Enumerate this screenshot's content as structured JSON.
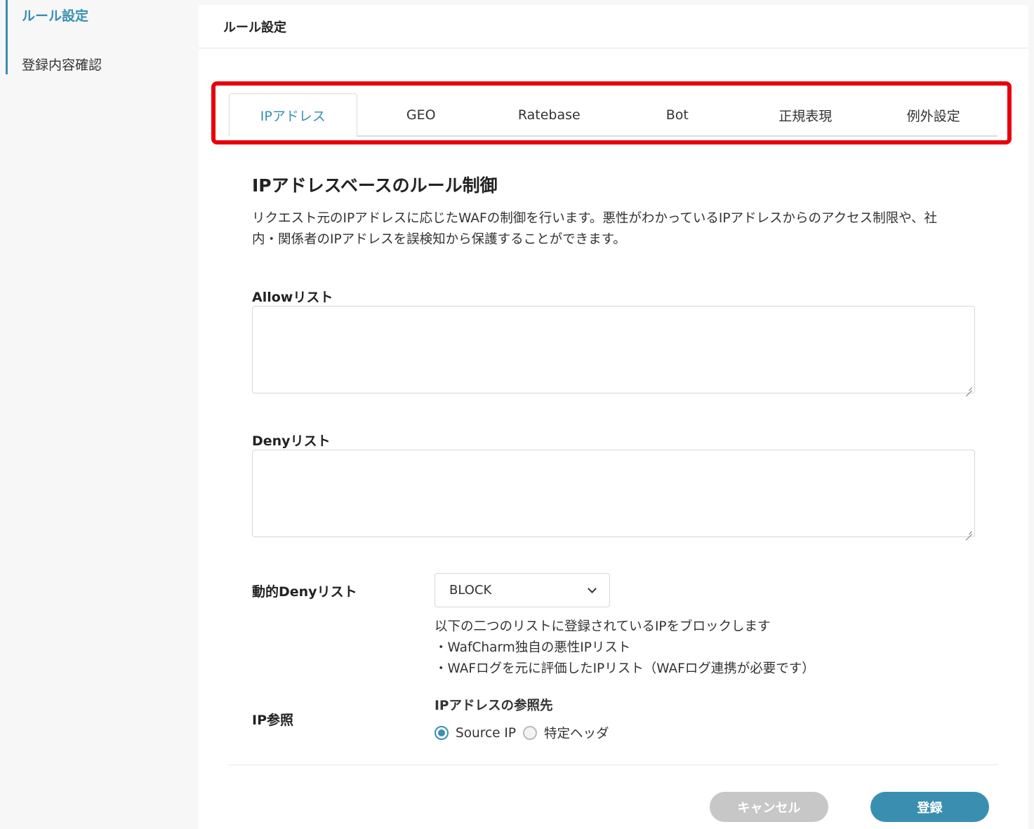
{
  "sidebar": {
    "items": [
      {
        "label": "ルール設定"
      },
      {
        "label": "登録内容確認"
      }
    ]
  },
  "header": {
    "title": "ルール設定"
  },
  "tabs": [
    {
      "label": "IPアドレス"
    },
    {
      "label": "GEO"
    },
    {
      "label": "Ratebase"
    },
    {
      "label": "Bot"
    },
    {
      "label": "正規表現"
    },
    {
      "label": "例外設定"
    }
  ],
  "section": {
    "title": "IPアドレスベースのルール制御",
    "description": "リクエスト元のIPアドレスに応じたWAFの制御を行います。悪性がわかっているIPアドレスからのアクセス制限や、社内・関係者のIPアドレスを誤検知から保護することができます。"
  },
  "allow": {
    "label": "Allowリスト",
    "value": ""
  },
  "deny": {
    "label": "Denyリスト",
    "value": ""
  },
  "dynamic_deny": {
    "label": "動的Denyリスト",
    "selected": "BLOCK",
    "desc_line1": "以下の二つのリストに登録されているIPをブロックします",
    "desc_line2": "・WafCharm独自の悪性IPリスト",
    "desc_line3": "・WAFログを元に評価したIPリスト（WAFログ連携が必要です）"
  },
  "ip_reference": {
    "label": "IP参照",
    "sub_label": "IPアドレスの参照先",
    "options": [
      {
        "label": "Source IP"
      },
      {
        "label": "特定ヘッダ"
      }
    ]
  },
  "buttons": {
    "cancel": "キャンセル",
    "submit": "登録"
  },
  "colors": {
    "accent": "#3a8fb0",
    "highlight": "#e8000b",
    "cancel": "#c7c7c7"
  }
}
